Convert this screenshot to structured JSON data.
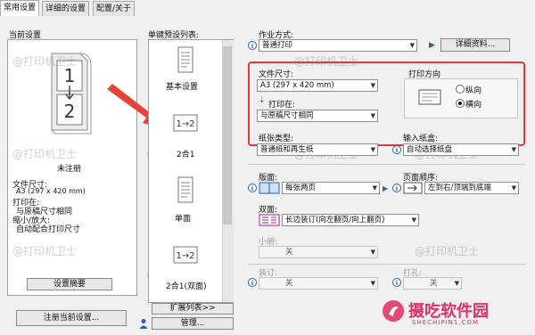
{
  "tabs": [
    "常用设置",
    "详细的设置",
    "配置/关于"
  ],
  "left": {
    "title": "当前设置",
    "status": "未注册",
    "lines": [
      "文件尺寸:",
      "A3 (297 x 420 mm)",
      "打印在:",
      "与原稿尺寸相同",
      "缩小/放大:",
      "自动配合打印尺寸"
    ],
    "preview_btn": "设置摘要",
    "register_btn": "注册当前设置..."
  },
  "presets": {
    "title": "单键预设列表:",
    "items": [
      "基本设置",
      "2合1",
      "单面",
      "2合1(双面)"
    ],
    "expand_btn": "扩展列表>>",
    "manage_btn": "管理..."
  },
  "form": {
    "job_label": "作业方式:",
    "job_value": "普通打印",
    "detail_btn": "详细资料...",
    "paper_size_label": "文件尺寸:",
    "paper_size_value": "A3 (297 x 420 mm)",
    "print_on_label": "打印在:",
    "print_on_value": "与原稿尺寸相同",
    "orientation_label": "打印方向",
    "orient_portrait": "纵向",
    "orient_landscape": "横向",
    "media_label": "纸张类型:",
    "media_value": "普通纸和再生纸",
    "source_label": "输入纸盒:",
    "source_value": "自动选择纸盘",
    "layout_label": "版面:",
    "layout_value": "每张两页",
    "order_label": "页面顺序:",
    "order_value": "左到右/顶端到底端",
    "duplex_label": "双面:",
    "duplex_value": "长边装订(向左翻页/向上翻页)",
    "booklet_label": "小册:",
    "booklet_value": "关",
    "staple_label": "装订:",
    "staple_value": "关",
    "punch_label": "打孔:",
    "punch_value": "关"
  },
  "watermark": "@打印机卫士",
  "brand": {
    "name": "摄吃软件园",
    "url": "SHECHIPIN1.COM"
  },
  "colors": {
    "highlight": "#e03b3b",
    "accent": "#2b5fb4",
    "arrow": "#e8413c"
  }
}
